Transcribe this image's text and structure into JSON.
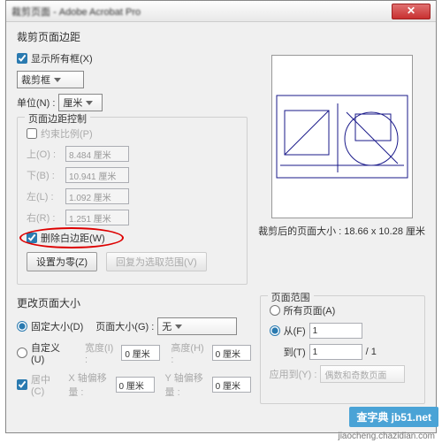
{
  "window": {
    "title": "裁剪页面",
    "subtitle": "- Adobe Acrobat Pro"
  },
  "section_margin_title": "裁剪页面边距",
  "show_all_boxes": {
    "label": "显示所有框(X)",
    "checked": true
  },
  "crop_box_combo": "裁剪框",
  "unit": {
    "label": "单位(N) :",
    "value": "厘米"
  },
  "margin_control": {
    "title": "页面边距控制",
    "constrain": {
      "label": "约束比例(P)",
      "checked": false
    },
    "top": {
      "label": "上(O) :",
      "value": "8.484 厘米"
    },
    "bottom": {
      "label": "下(B) :",
      "value": "10.941 厘米"
    },
    "left": {
      "label": "左(L) :",
      "value": "1.092 厘米"
    },
    "right": {
      "label": "右(R) :",
      "value": "1.251 厘米"
    },
    "remove_white": {
      "label": "删除白边距(W)",
      "checked": true
    },
    "set_zero": "设置为零(Z)",
    "revert": "回复为选取范围(V)"
  },
  "preview_caption_prefix": "裁剪后的页面大小 : ",
  "preview_size": "18.66 x 10.28 厘米",
  "change_size": {
    "title": "更改页面大小",
    "fixed": {
      "label": "固定大小(D)",
      "checked": true
    },
    "page_size_label": "页面大小(G) :",
    "page_size_value": "无",
    "custom": {
      "label": "自定义(U)"
    },
    "width_label": "宽度(I) :",
    "width_value": "0 厘米",
    "height_label": "高度(H) :",
    "height_value": "0 厘米",
    "center": {
      "label": "居中(C)",
      "checked": true
    },
    "xoffset_label": "X 轴偏移量 :",
    "xoffset_value": "0 厘米",
    "yoffset_label": "Y 轴偏移量 :",
    "yoffset_value": "0 厘米"
  },
  "page_range": {
    "title": "页面范围",
    "all": {
      "label": "所有页面(A)"
    },
    "from": {
      "label": "从(F)",
      "value": "1",
      "checked": true
    },
    "to": {
      "label": "到(T)",
      "value": "1",
      "total": "/ 1"
    },
    "apply_label": "应用到(Y) :",
    "apply_value": "偶数和奇数页面"
  },
  "watermark": {
    "badge": "查字典 jb51.net",
    "url": "jiaocheng.chazidian.com"
  }
}
